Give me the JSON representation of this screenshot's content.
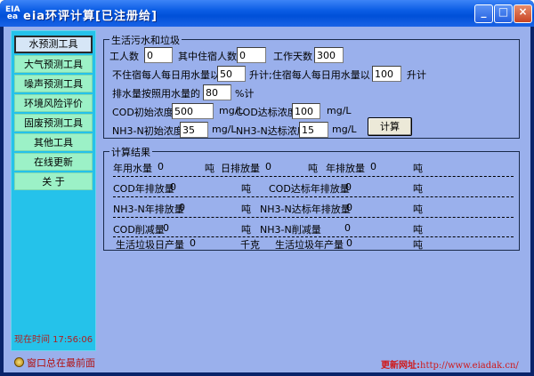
{
  "window": {
    "title": "eia环评计算[已注册给]",
    "icon": "eia-app-icon",
    "min": "_",
    "max": "□",
    "close": "×"
  },
  "sidebar": {
    "items": [
      {
        "label": "水预测工具",
        "active": true
      },
      {
        "label": "大气预测工具"
      },
      {
        "label": "噪声预测工具"
      },
      {
        "label": "环境风险评价"
      },
      {
        "label": "固废预测工具"
      },
      {
        "label": "其他工具"
      },
      {
        "label": "在线更新"
      },
      {
        "label": "关 于"
      }
    ],
    "clock": "现在时间 17:56:06"
  },
  "status": {
    "pin_label": "窗口总在最前面",
    "update_label": "更新网址:",
    "update_url": "http://www.eiadak.cn/"
  },
  "input_group": {
    "legend": "生活污水和垃圾",
    "workers_label": "工人数",
    "workers_value": "0",
    "residents_label": "其中住宿人数",
    "residents_value": "0",
    "days_label": "工作天数",
    "days_value": "300",
    "nonres_label": "不住宿每人每日用水量以",
    "nonres_value": "50",
    "res_label": "升计;住宿每人每日用水量以",
    "res_value": "100",
    "res_unit": "升计",
    "discharge_label": "排水量按照用水量的",
    "discharge_value": "80",
    "discharge_unit": "%计",
    "cod_init_label": "COD初始浓度",
    "cod_init_value": "500",
    "cod_init_unit": "mg/L",
    "cod_std_label": "COD达标浓度",
    "cod_std_value": "100",
    "cod_std_unit": "mg/L",
    "nh3_init_label": "NH3-N初始浓度",
    "nh3_init_value": "35",
    "nh3_init_unit": "mg/L",
    "nh3_std_label": "NH3-N达标浓度",
    "nh3_std_value": "15",
    "nh3_std_unit": "mg/L",
    "calc_button": "计算"
  },
  "results": {
    "legend": "计算结果",
    "water_year_label": "年用水量",
    "water_year_value": "0",
    "water_year_unit": "吨",
    "daily_disch_label": "日排放量",
    "daily_disch_value": "0",
    "daily_disch_unit": "吨",
    "year_disch_label": "年排放量",
    "year_disch_value": "0",
    "year_disch_unit": "吨",
    "cod_year_label": "COD年排放量",
    "cod_year_value": "0",
    "cod_year_unit": "吨",
    "cod_std_year_label": "COD达标年排放量",
    "cod_std_year_value": "0",
    "cod_std_year_unit": "吨",
    "nh3_year_label": "NH3-N年排放量",
    "nh3_year_value": "0",
    "nh3_year_unit": "吨",
    "nh3_std_year_label": "NH3-N达标年排放量",
    "nh3_std_year_value": "0",
    "nh3_std_year_unit": "吨",
    "cod_reduce_label": "COD削减量",
    "cod_reduce_value": "0",
    "cod_reduce_unit": "吨",
    "nh3_reduce_label": "NH3-N削减量",
    "nh3_reduce_value": "0",
    "nh3_reduce_unit": "吨",
    "garbage_day_label": "生活垃圾日产量",
    "garbage_day_value": "0",
    "garbage_day_unit": "千克",
    "garbage_year_label": "生活垃圾年产量",
    "garbage_year_value": "0",
    "garbage_year_unit": "吨"
  }
}
